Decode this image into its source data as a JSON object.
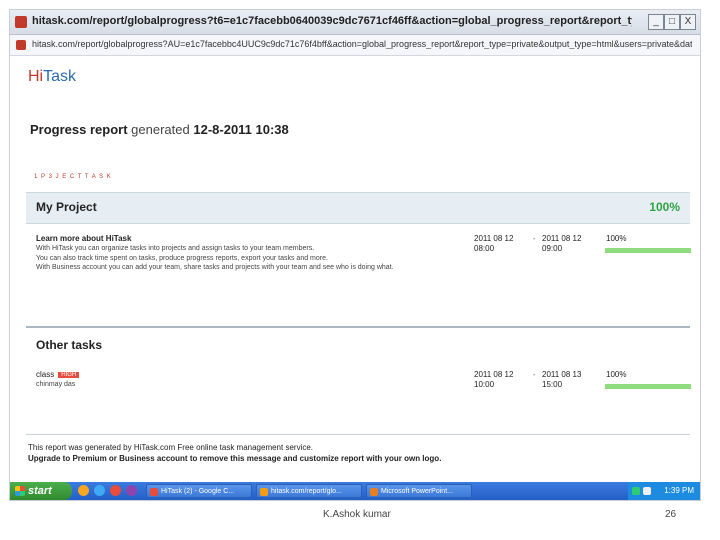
{
  "browser": {
    "title": "hitask.com/report/globalprogress?t6=e1c7facebb0640039c9dc7671cf46ff&action=global_progress_report&report_type=private&output_ty...",
    "url": "hitask.com/report/globalprogress?AU=e1c7facebbc4UUC9c9dc71c76f4bff&action=global_progress_report&report_type=private&output_type=html&users=private&dates=all",
    "window_buttons": {
      "minimize": "_",
      "maximize": "□",
      "close": "X"
    }
  },
  "app": {
    "logo_hi": "Hi",
    "logo_task": "Task"
  },
  "report": {
    "title": "Progress report",
    "generated_label": "generated",
    "generated_datetime": "12-8-2011 10:38",
    "scope_link": "1 P 3 J E C T   T A S K"
  },
  "project": {
    "name": "My Project",
    "percent": "100%",
    "progress": 1.0,
    "tasks": [
      {
        "name": "Learn more about HiTask",
        "description": [
          "With HiTask you can organize tasks into projects and assign tasks to your team members.",
          "You can also track time spent on tasks, produce progress reports, export your tasks and more.",
          "With Business account you can add your team, share tasks and projects with your team and see who is doing what."
        ],
        "start_date": "2011 08 12",
        "start_time": "08:00",
        "end_date": "2011 08 12",
        "end_time": "09:00",
        "percent": "100%",
        "progress": 1.0
      }
    ]
  },
  "other_tasks": {
    "title": "Other tasks",
    "tasks": [
      {
        "name": "class",
        "badge": "HIGH",
        "subtitle": "chinmay das",
        "start_date": "2011 08 12",
        "start_time": "10:00",
        "end_date": "2011 08 13",
        "end_time": "15:00",
        "percent": "100%",
        "progress": 1.0
      }
    ]
  },
  "footer": {
    "line1": "This report was generated by HiTask.com Free online task management service.",
    "line2": "Upgrade to Premium or Business account to remove this message and customize report with your own logo."
  },
  "taskbar": {
    "start_label": "start",
    "buttons": [
      {
        "label": "HiTask (2) - Google C...",
        "icon_color": "#e74c3c"
      },
      {
        "label": "hitask.com/report/glo...",
        "icon_color": "#f39c12"
      },
      {
        "label": "Microsoft PowerPoint...",
        "icon_color": "#e67e22"
      }
    ],
    "clock": "1:39 PM"
  },
  "slide": {
    "footer_text": "K.Ashok kumar",
    "page_number": "26"
  }
}
